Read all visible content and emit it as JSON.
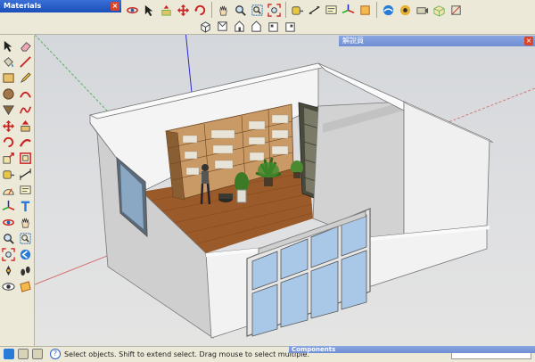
{
  "windows": {
    "materials_title": "Materials",
    "explainer_title": "解說員",
    "components_title": "Components",
    "close_glyph": "×"
  },
  "status": {
    "hint": "Select objects. Shift to extend select. Drag mouse to select multiple.",
    "help_glyph": "?",
    "field_value": ""
  },
  "toolbar_top_icons": [
    "orbit-icon",
    "select-icon",
    "push-pull-icon",
    "move-icon",
    "rotate-icon",
    "offset-icon",
    "pan-icon",
    "zoom-icon",
    "zoom-extents-icon",
    "tape-icon",
    "dimension-icon",
    "text-icon",
    "axes-icon",
    "section-icon",
    "walk-icon",
    "look-around-icon",
    "position-camera-icon"
  ],
  "toolbar_view_icons": [
    "iso-view-icon",
    "top-view-icon",
    "front-view-icon",
    "right-view-icon",
    "back-view-icon",
    "left-view-icon"
  ],
  "left_tool_icons": [
    "select-icon",
    "eraser-icon",
    "paint-bucket-icon",
    "line-icon",
    "rectangle-icon",
    "pencil-icon",
    "circle-icon",
    "arc-icon",
    "polygon-icon",
    "freehand-icon",
    "move-icon",
    "push-pull-icon",
    "rotate-icon",
    "follow-me-icon",
    "scale-icon",
    "offset-icon",
    "tape-measure-icon",
    "dimension-icon",
    "protractor-icon",
    "text-icon",
    "axes-icon",
    "3d-text-icon",
    "orbit-icon",
    "pan-icon",
    "zoom-icon",
    "zoom-window-icon",
    "zoom-extents-icon",
    "previous-view-icon",
    "position-camera-icon",
    "walk-icon",
    "look-around-icon",
    "section-plane-icon"
  ],
  "colors": {
    "chrome": "#ece9d8",
    "title_bar_active": "#2a5fc8",
    "title_bar_inactive": "#7a98d8",
    "wall": "#f2f2f2",
    "wall_shade": "#d6d6d6",
    "floor": "#9a5a2a",
    "glass": "#a9c8e8",
    "sky": "#d6d9dd"
  }
}
